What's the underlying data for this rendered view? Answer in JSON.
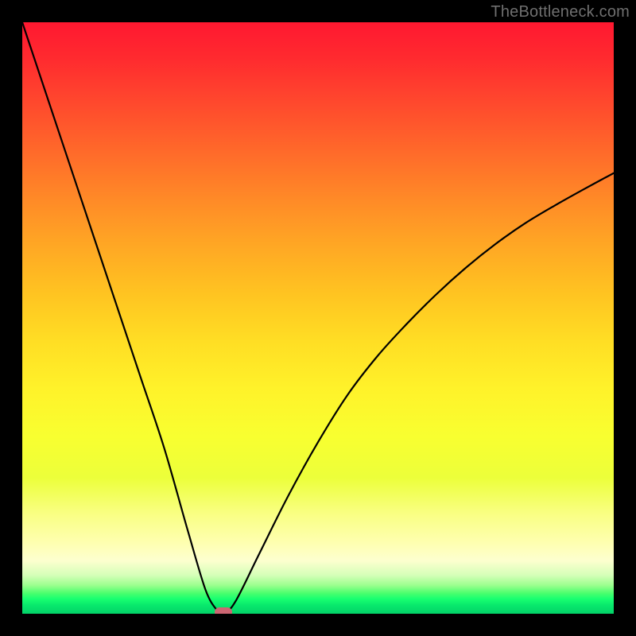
{
  "watermark": "TheBottleneck.com",
  "chart_data": {
    "type": "line",
    "title": "",
    "xlabel": "",
    "ylabel": "",
    "xlim": [
      0,
      100
    ],
    "ylim": [
      0,
      100
    ],
    "grid": false,
    "legend": false,
    "annotations": [],
    "gradient_stops": [
      {
        "pos": 0,
        "color": "#ff1830"
      },
      {
        "pos": 50,
        "color": "#ffd023"
      },
      {
        "pos": 88,
        "color": "#feffb0"
      },
      {
        "pos": 96,
        "color": "#4cff6e"
      },
      {
        "pos": 100,
        "color": "#03d268"
      }
    ],
    "series": [
      {
        "name": "bottleneck-curve",
        "x": [
          0,
          4,
          8,
          12,
          16,
          20,
          24,
          28,
          31,
          33,
          34,
          36,
          40,
          45,
          50,
          55,
          60,
          65,
          70,
          75,
          80,
          85,
          90,
          95,
          100
        ],
        "values": [
          100,
          88,
          76,
          64,
          52,
          40,
          28,
          14,
          4,
          0.5,
          0,
          2,
          10,
          20,
          29,
          37,
          43.5,
          49,
          54,
          58.5,
          62.5,
          66,
          69,
          71.8,
          74.5
        ]
      }
    ],
    "marker": {
      "x": 34,
      "y": 0,
      "color": "#cc6672"
    }
  }
}
